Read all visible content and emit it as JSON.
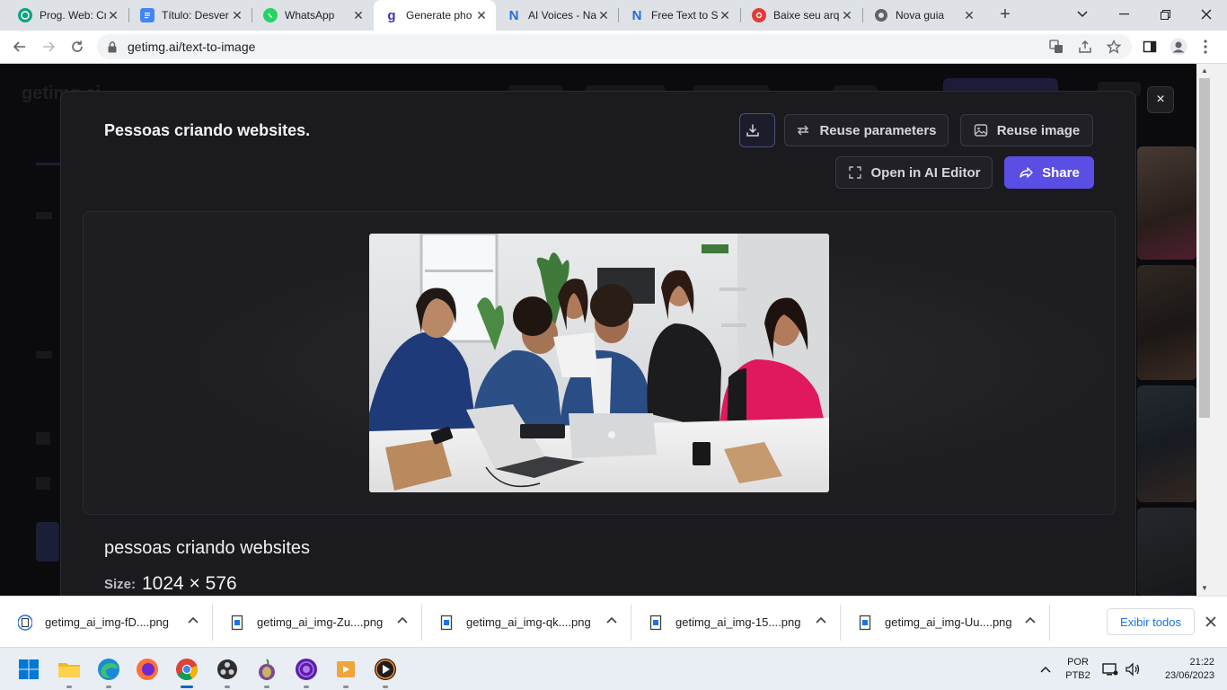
{
  "browser": {
    "tabs": [
      {
        "title": "Prog. Web: Cr",
        "favicon": "chatgpt-icon",
        "color": "#10a37f"
      },
      {
        "title": "Título: Desver",
        "favicon": "docs-icon",
        "color": "#4285f4"
      },
      {
        "title": "WhatsApp",
        "favicon": "whatsapp-icon",
        "color": "#25d366"
      },
      {
        "title": "Generate pho",
        "favicon": "getimg-icon",
        "color": "#5b4ee5",
        "active": true
      },
      {
        "title": "AI Voices - Na",
        "favicon": "n-icon",
        "color": "#1e6fd9"
      },
      {
        "title": "Free Text to S",
        "favicon": "n-icon",
        "color": "#1e6fd9"
      },
      {
        "title": "Baixe seu arq",
        "favicon": "red-circle-icon",
        "color": "#e53935"
      },
      {
        "title": "Nova guia",
        "favicon": "chrome-icon",
        "color": "#5f6368"
      }
    ],
    "url": "getimg.ai/text-to-image"
  },
  "background": {
    "logo": "getimg.ai"
  },
  "modal": {
    "title": "Pessoas criando websites.",
    "download_label": "",
    "reuse_parameters_label": "Reuse parameters",
    "reuse_image_label": "Reuse image",
    "open_editor_label": "Open in AI Editor",
    "share_label": "Share",
    "prompt": "pessoas criando websites",
    "size_label": "Size:",
    "size_value": "1024 × 576",
    "close_label": "×"
  },
  "downloads": {
    "items": [
      {
        "name": "getimg_ai_img-fD....png"
      },
      {
        "name": "getimg_ai_img-Zu....png"
      },
      {
        "name": "getimg_ai_img-qk....png"
      },
      {
        "name": "getimg_ai_img-15....png"
      },
      {
        "name": "getimg_ai_img-Uu....png"
      }
    ],
    "show_all_label": "Exibir todos"
  },
  "taskbar": {
    "apps": [
      "start-icon",
      "file-explorer-icon",
      "edge-icon",
      "firefox-icon",
      "chrome-icon",
      "obs-icon",
      "tor-icon",
      "music-icon",
      "media-player-icon",
      "play-icon"
    ],
    "lang_line1": "POR",
    "lang_line2": "PTB2",
    "time": "21:22",
    "date": "23/06/2023"
  },
  "colors": {
    "accent": "#5b4ee5",
    "modal_bg": "#1b1b1f",
    "page_bg": "#0d0d10"
  }
}
